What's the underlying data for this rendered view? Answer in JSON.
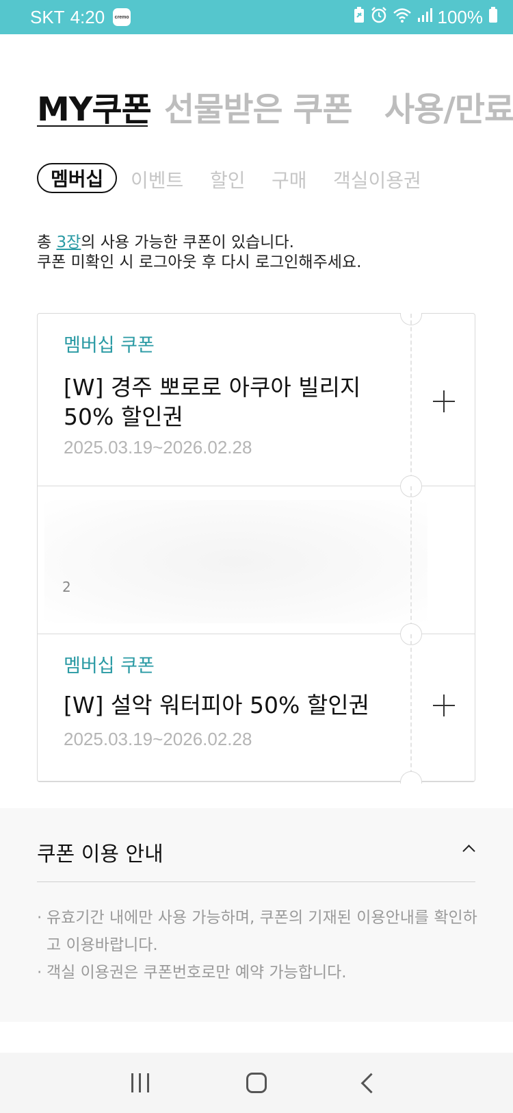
{
  "status_bar": {
    "carrier": "SKT",
    "time": "4:20",
    "app_icon_text": "cremo",
    "battery": "100%"
  },
  "top_tabs": [
    {
      "label": "MY쿠폰",
      "active": true
    },
    {
      "label": "선물받은 쿠폰",
      "active": false
    },
    {
      "label": "사용/만료",
      "active": false
    }
  ],
  "sub_tabs": [
    {
      "label": "멤버십",
      "active": true
    },
    {
      "label": "이벤트",
      "active": false
    },
    {
      "label": "할인",
      "active": false
    },
    {
      "label": "구매",
      "active": false
    },
    {
      "label": "객실이용권",
      "active": false
    }
  ],
  "info": {
    "prefix": "총 ",
    "count": "3장",
    "suffix": "의 사용 가능한 쿠폰이 있습니다.",
    "line2": "쿠폰 미확인 시 로그아웃 후 다시 로그인해주세요."
  },
  "coupons": [
    {
      "type": "멤버십 쿠폰",
      "title": "[W] 경주 뽀로로 아쿠아 빌리지 50% 할인권",
      "period": "2025.03.19~2026.02.28"
    },
    {
      "type": "",
      "title": "",
      "period": "2"
    },
    {
      "type": "멤버십 쿠폰",
      "title": "[W] 설악 워터피아 50% 할인권",
      "period": "2025.03.19~2026.02.28"
    }
  ],
  "guide": {
    "title": "쿠폰 이용 안내",
    "items": [
      "유효기간 내에만 사용 가능하며, 쿠폰의 기재된 이용안내를 확인하고 이용바랍니다.",
      "객실 이용권은 쿠폰번호로만 예약 가능합니다."
    ]
  },
  "colors": {
    "status_bar": "#55c6cd",
    "accent": "#2a9aa4"
  }
}
